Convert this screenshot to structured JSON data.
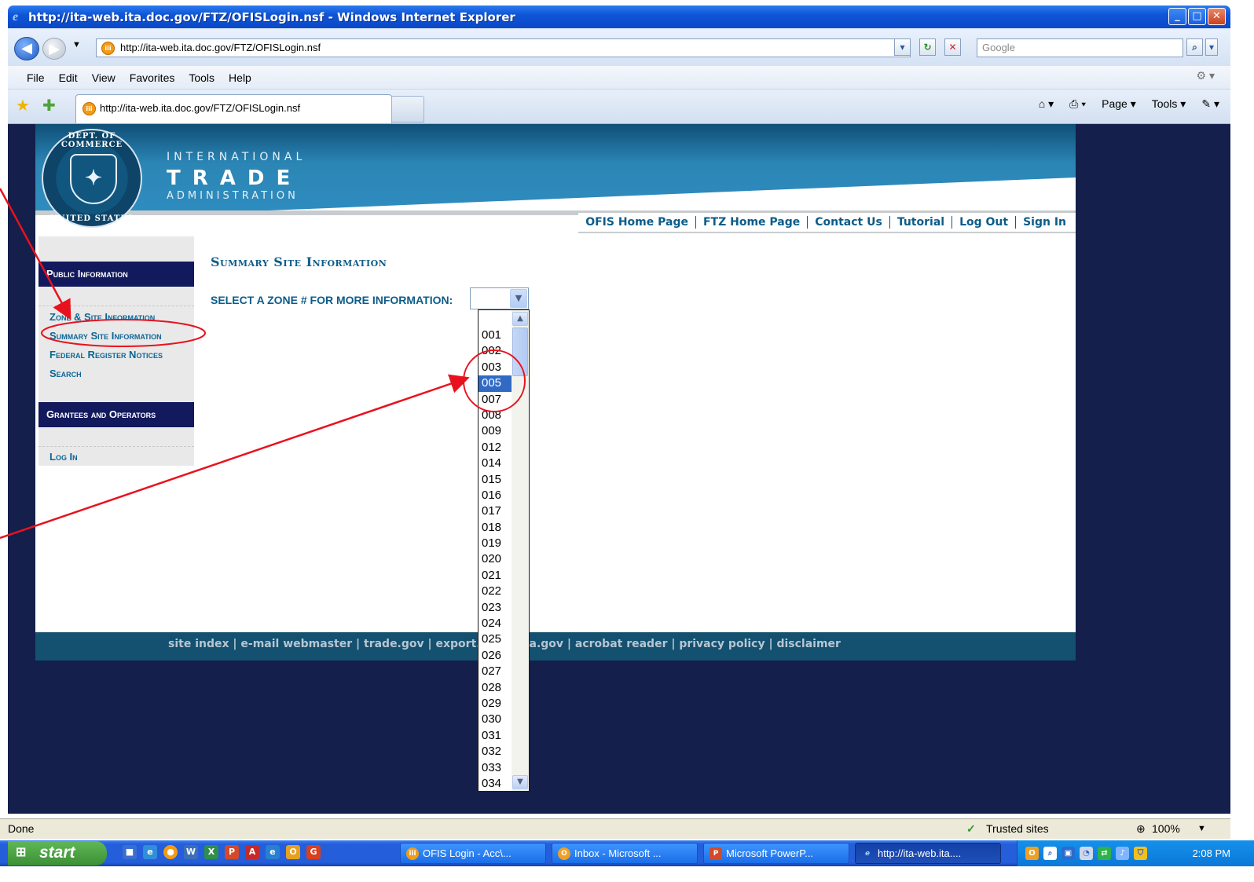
{
  "window": {
    "title": "http://ita-web.ita.doc.gov/FTZ/OFISLogin.nsf - Windows Internet Explorer",
    "buttons": {
      "minimize": "_",
      "maximize": "□",
      "close": "✕"
    }
  },
  "address_bar": {
    "url": "http://ita-web.ita.doc.gov/FTZ/OFISLogin.nsf",
    "search_placeholder": "Google"
  },
  "menu": [
    "File",
    "Edit",
    "View",
    "Favorites",
    "Tools",
    "Help"
  ],
  "tab": {
    "label": "http://ita-web.ita.doc.gov/FTZ/OFISLogin.nsf"
  },
  "command_bar": {
    "page": "Page ▾",
    "tools": "Tools ▾"
  },
  "site": {
    "logo": {
      "line1": "INTERNATIONAL",
      "line2": "TRADE",
      "line3": "ADMINISTRATION",
      "seal_top": "DEPARTMENT OF COMMERCE",
      "seal_bottom": "UNITED STATES OF AMERICA"
    },
    "top_links": [
      "OFIS Home Page",
      "FTZ Home Page",
      "Contact Us",
      "Tutorial",
      "Log Out",
      "Sign In"
    ],
    "sidebar": {
      "public_header": "Public Information",
      "public_links": [
        "Zone & Site Information",
        "Summary Site Information",
        "Federal Register Notices",
        "Search"
      ],
      "grantees_header": "Grantees and Operators",
      "grantee_links": [
        "Log In"
      ]
    },
    "page_title": "Summary Site Information",
    "select_label": "SELECT A ZONE # FOR MORE INFORMATION:",
    "zone_options": [
      "001",
      "002",
      "003",
      "005",
      "007",
      "008",
      "009",
      "012",
      "014",
      "015",
      "016",
      "017",
      "018",
      "019",
      "020",
      "021",
      "022",
      "023",
      "024",
      "025",
      "026",
      "027",
      "028",
      "029",
      "030",
      "031",
      "032",
      "033",
      "034"
    ],
    "selected_zone": "005",
    "footer": "site index | e-mail webmaster | trade.gov | export.gov | usa.gov | acrobat reader | privacy policy | disclaimer"
  },
  "status_bar": {
    "left": "Done",
    "zone": "Trusted sites",
    "zoom": "100%"
  },
  "taskbar": {
    "start": "start",
    "items": [
      "OFIS Login - Acc\\...",
      "Inbox - Microsoft ...",
      "Microsoft PowerP...",
      "http://ita-web.ita...."
    ],
    "clock": "2:08 PM"
  },
  "colors": {
    "annotation_red": "#e8121e",
    "title_blue": "#0d5c8a",
    "sidebar_header": "#12195c",
    "page_background": "#141f4b"
  }
}
